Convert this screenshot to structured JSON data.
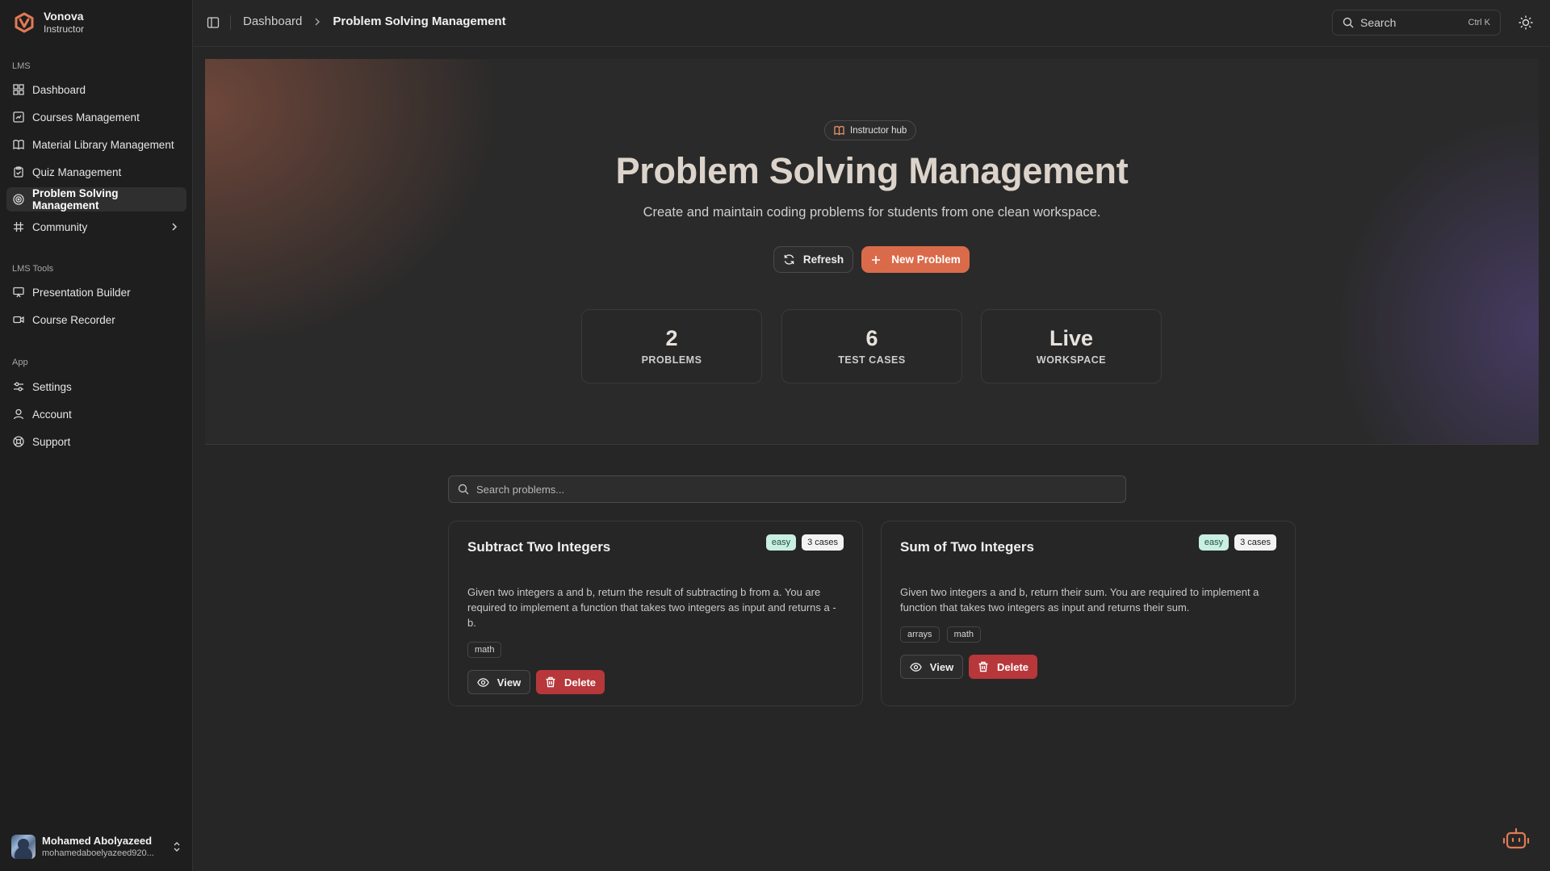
{
  "brand": {
    "name": "Vonova",
    "role": "Instructor"
  },
  "sidebar": {
    "groups": [
      {
        "label": "LMS",
        "items": [
          {
            "label": "Dashboard",
            "icon": "dashboard-icon"
          },
          {
            "label": "Courses Management",
            "icon": "courses-icon"
          },
          {
            "label": "Material Library Management",
            "icon": "book-icon"
          },
          {
            "label": "Quiz Management",
            "icon": "clipboard-icon"
          },
          {
            "label": "Problem Solving Management",
            "icon": "target-icon",
            "active": true
          },
          {
            "label": "Community",
            "icon": "hash-icon",
            "has_submenu": true
          }
        ]
      },
      {
        "label": "LMS Tools",
        "items": [
          {
            "label": "Presentation Builder",
            "icon": "presentation-icon"
          },
          {
            "label": "Course Recorder",
            "icon": "video-icon"
          }
        ]
      },
      {
        "label": "App",
        "items": [
          {
            "label": "Settings",
            "icon": "sliders-icon"
          },
          {
            "label": "Account",
            "icon": "user-icon"
          },
          {
            "label": "Support",
            "icon": "lifebuoy-icon"
          }
        ]
      }
    ]
  },
  "user": {
    "name": "Mohamed Abolyazeed",
    "email": "mohamedaboelyazeed920..."
  },
  "topbar": {
    "breadcrumbs": [
      "Dashboard",
      "Problem Solving Management"
    ],
    "search_label": "Search",
    "search_shortcut": "Ctrl K"
  },
  "hero": {
    "pill": "Instructor hub",
    "title": "Problem Solving Management",
    "subtitle": "Create and maintain coding problems for students from one clean workspace.",
    "refresh_label": "Refresh",
    "new_label": "New Problem",
    "accent": "#d96b4a",
    "stats": [
      {
        "value": "2",
        "label": "PROBLEMS"
      },
      {
        "value": "6",
        "label": "TEST CASES"
      },
      {
        "value": "Live",
        "label": "WORKSPACE"
      }
    ]
  },
  "problems": {
    "search_placeholder": "Search problems...",
    "view_label": "View",
    "delete_label": "Delete",
    "items": [
      {
        "title": "Subtract Two Integers",
        "difficulty": "easy",
        "cases": "3 cases",
        "description": "Given two integers a and b, return the result of subtracting b from a. You are required to implement a function that takes two integers as input and returns a - b.",
        "tags": [
          "math"
        ]
      },
      {
        "title": "Sum of Two Integers",
        "difficulty": "easy",
        "cases": "3 cases",
        "description": "Given two integers a and b, return their sum. You are required to implement a function that takes two integers as input and returns their sum.",
        "tags": [
          "arrays",
          "math"
        ]
      }
    ]
  },
  "colors": {
    "danger": "#b7373a",
    "easy_badge": "#c8efe1"
  }
}
